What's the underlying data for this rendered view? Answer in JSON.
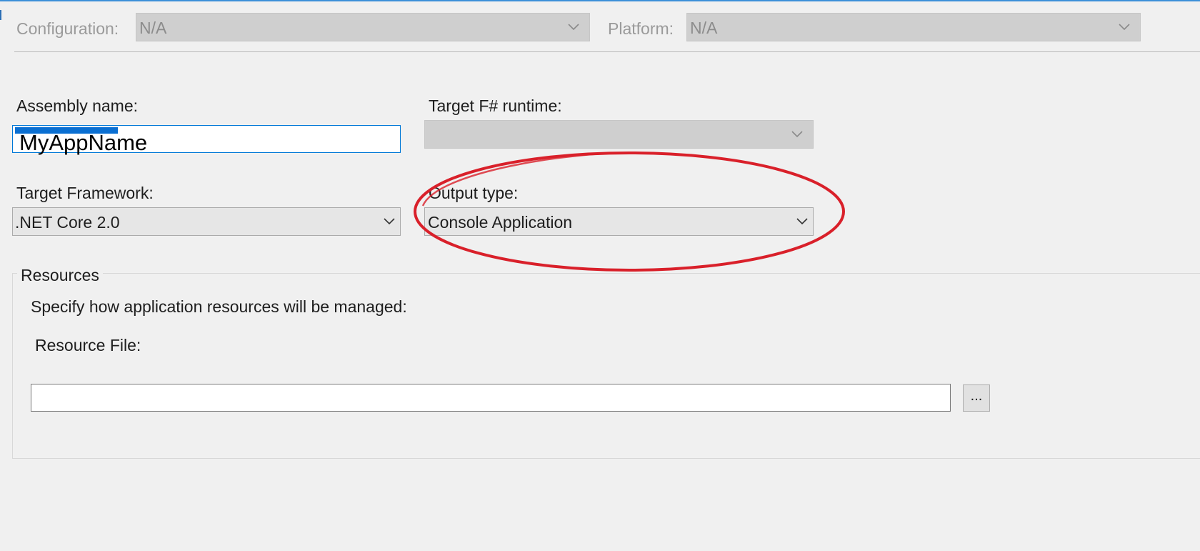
{
  "config_bar": {
    "configuration_label": "Configuration:",
    "configuration_value": "N/A",
    "platform_label": "Platform:",
    "platform_value": "N/A"
  },
  "application": {
    "assembly_name_label": "Assembly name:",
    "assembly_name_value": "MyAppName",
    "target_runtime_label": "Target F# runtime:",
    "target_runtime_value": "",
    "target_framework_label": "Target Framework:",
    "target_framework_value": ".NET Core 2.0",
    "output_type_label": "Output type:",
    "output_type_value": "Console Application"
  },
  "resources": {
    "group_title": "Resources",
    "description": "Specify how application resources will be managed:",
    "resource_file_label": "Resource File:",
    "resource_file_value": "",
    "browse_label": "..."
  },
  "annotation": {
    "shape": "ellipse",
    "color": "#d9202a"
  },
  "colors": {
    "accent": "#0078d7",
    "background": "#f0f0f0"
  }
}
